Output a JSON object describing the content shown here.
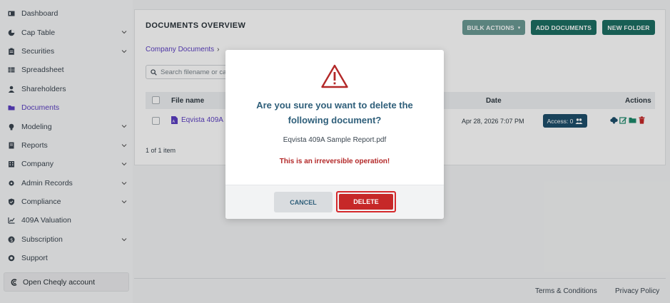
{
  "sidebar": {
    "items": [
      {
        "label": "Dashboard",
        "icon": "dashboard-icon",
        "chevron": false,
        "active": false
      },
      {
        "label": "Cap Table",
        "icon": "pie-chart-icon",
        "chevron": true,
        "active": false
      },
      {
        "label": "Securities",
        "icon": "clipboard-icon",
        "chevron": true,
        "active": false
      },
      {
        "label": "Spreadsheet",
        "icon": "table-icon",
        "chevron": false,
        "active": false
      },
      {
        "label": "Shareholders",
        "icon": "user-icon",
        "chevron": false,
        "active": false
      },
      {
        "label": "Documents",
        "icon": "folder-icon",
        "chevron": false,
        "active": true
      },
      {
        "label": "Modeling",
        "icon": "lightbulb-icon",
        "chevron": true,
        "active": false
      },
      {
        "label": "Reports",
        "icon": "report-icon",
        "chevron": true,
        "active": false
      },
      {
        "label": "Company",
        "icon": "building-icon",
        "chevron": true,
        "active": false
      },
      {
        "label": "Admin Records",
        "icon": "gear-icon",
        "chevron": true,
        "active": false
      },
      {
        "label": "Compliance",
        "icon": "shield-check-icon",
        "chevron": true,
        "active": false
      },
      {
        "label": "409A Valuation",
        "icon": "chart-line-icon",
        "chevron": false,
        "active": false
      },
      {
        "label": "Subscription",
        "icon": "dollar-icon",
        "chevron": true,
        "active": false
      },
      {
        "label": "Support",
        "icon": "lifebuoy-icon",
        "chevron": false,
        "active": false
      }
    ],
    "open_account": "Open Cheqly account"
  },
  "main": {
    "title": "DOCUMENTS OVERVIEW",
    "bulk_actions": "BULK ACTIONS",
    "add_documents": "ADD DOCUMENTS",
    "new_folder": "NEW FOLDER",
    "breadcrumb": "Company Documents",
    "search_placeholder": "Search filename or ca",
    "columns": {
      "file_name": "File name",
      "date": "Date",
      "actions": "Actions"
    },
    "row": {
      "file_name": "Eqvista 409A",
      "date": "Apr 28, 2026 7:07 PM",
      "access": "Access: 0"
    },
    "count": "1 of 1 item"
  },
  "footer": {
    "terms": "Terms & Conditions",
    "privacy": "Privacy Policy"
  },
  "modal": {
    "title": "Are you sure you want to delete the following document?",
    "document": "Eqvista 409A Sample Report.pdf",
    "warning": "This is an irreversible operation!",
    "cancel": "CANCEL",
    "delete": "DELETE"
  },
  "colors": {
    "accent_purple": "#5b3fc2",
    "primary_green": "#1d6f63",
    "danger_red": "#c62828",
    "modal_title": "#2f5f7a"
  }
}
